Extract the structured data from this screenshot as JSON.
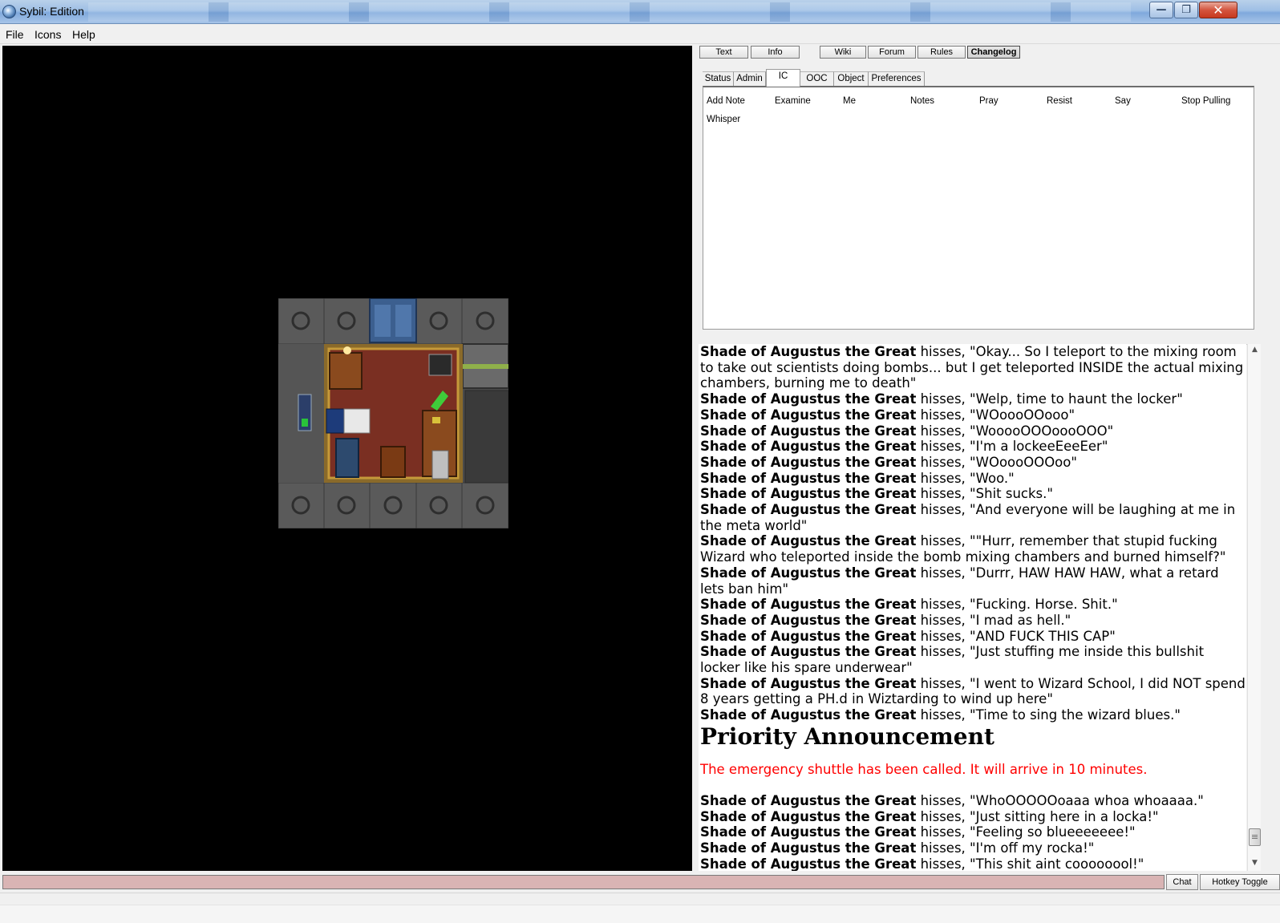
{
  "window": {
    "title": "Sybil: Edition",
    "controls": {
      "minimize": "—",
      "maximize": "❐",
      "close": "✕"
    }
  },
  "menu": [
    "File",
    "Icons",
    "Help"
  ],
  "top_buttons": {
    "text": "Text",
    "info": "Info",
    "wiki": "Wiki",
    "forum": "Forum",
    "rules": "Rules",
    "changelog": "Changelog"
  },
  "tabs": [
    "Status",
    "Admin",
    "IC",
    "OOC",
    "Object",
    "Preferences"
  ],
  "active_tab": "IC",
  "verbs": [
    "Add Note",
    "Examine",
    "Me",
    "Notes",
    "Pray",
    "Resist",
    "Say",
    "Stop Pulling",
    "Whisper"
  ],
  "chat": {
    "speaker": "Shade of Augustus the Great",
    "before_announcement": [
      {
        "verb": " hisses, ",
        "text": "\"Okay... So I teleport to the mixing room to take out scientists doing bombs... but I get teleported INSIDE the actual mixing chambers, burning me to death\""
      },
      {
        "verb": " hisses, ",
        "text": "\"Welp, time to haunt the locker\""
      },
      {
        "verb": " hisses, ",
        "text": "\"WOoooOOooo\""
      },
      {
        "verb": " hisses, ",
        "text": "\"WooooOOOoooOOO\""
      },
      {
        "verb": " hisses, ",
        "text": "\"I'm a lockeeEeeEer\""
      },
      {
        "verb": " hisses, ",
        "text": "\"WOoooOOOoo\""
      },
      {
        "verb": " hisses, ",
        "text": "\"Woo.\""
      },
      {
        "verb": " hisses, ",
        "text": "\"Shit sucks.\""
      },
      {
        "verb": " hisses, ",
        "text": "\"And everyone will be laughing at me in the meta world\""
      },
      {
        "verb": " hisses, ",
        "text": "\"\"Hurr, remember that stupid fucking Wizard who teleported inside the bomb mixing chambers and burned himself?\""
      },
      {
        "verb": " hisses, ",
        "text": "\"Durrr, HAW HAW HAW, what a retard lets ban him\""
      },
      {
        "verb": " hisses, ",
        "text": "\"Fucking. Horse. Shit.\""
      },
      {
        "verb": " hisses, ",
        "text": "\"I mad as hell.\""
      },
      {
        "verb": " hisses, ",
        "text": "\"AND FUCK THIS CAP\""
      },
      {
        "verb": " hisses, ",
        "text": "\"Just stuffing me inside this bullshit locker like his spare underwear\""
      },
      {
        "verb": " hisses, ",
        "text": "\"I went to Wizard School, I did NOT spend 8 years getting a PH.d in Wiztarding to wind up here\""
      },
      {
        "verb": " hisses, ",
        "text": "\"Time to sing the wizard blues.\""
      }
    ],
    "announcement_title": "Priority Announcement",
    "announcement_text": "The emergency shuttle has been called. It will arrive in 10 minutes.",
    "announcement_color": "#ff0000",
    "after_announcement": [
      {
        "verb": " hisses, ",
        "text": "\"WhoOOOOOoaaa whoa whoaaaa.\""
      },
      {
        "verb": " hisses, ",
        "text": "\"Just sitting here in a locka!\""
      },
      {
        "verb": " hisses, ",
        "text": "\"Feeling so blueeeeeee!\""
      },
      {
        "verb": " hisses, ",
        "text": "\"I'm off my rocka!\""
      },
      {
        "verb": " hisses, ",
        "text": "\"This shit aint coooooool!\""
      }
    ]
  },
  "bottom_buttons": {
    "chat": "Chat",
    "hotkey": "Hotkey Toggle"
  },
  "colors": {
    "map_bg": "#000000",
    "input_bg": "#d9b4b4",
    "title_gradient": "#9ebfe5"
  }
}
